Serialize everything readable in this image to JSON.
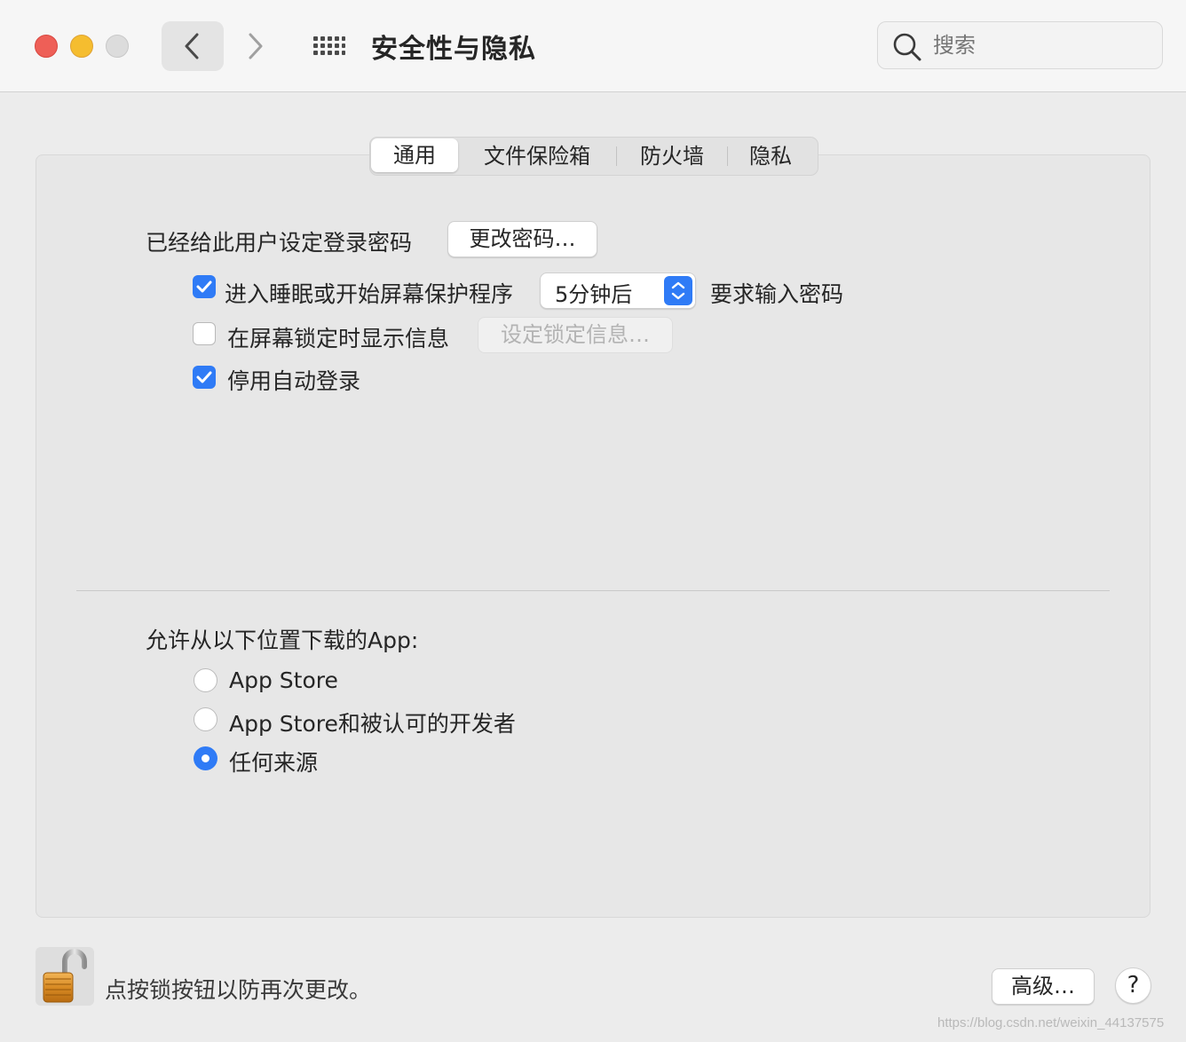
{
  "window": {
    "title": "安全性与隐私",
    "search_placeholder": "搜索"
  },
  "tabs": [
    {
      "label": "通用",
      "active": true
    },
    {
      "label": "文件保险箱",
      "active": false
    },
    {
      "label": "防火墙",
      "active": false
    },
    {
      "label": "隐私",
      "active": false
    }
  ],
  "general": {
    "password_set_label": "已经给此用户设定登录密码",
    "change_password_button": "更改密码…",
    "require_password": {
      "checked": true,
      "label_before": "进入睡眠或开始屏幕保护程序",
      "delay_value": "5分钟后",
      "label_after": "要求输入密码"
    },
    "show_message": {
      "checked": false,
      "label": "在屏幕锁定时显示信息",
      "button": "设定锁定信息…",
      "button_enabled": false
    },
    "disable_autologin": {
      "checked": true,
      "label": "停用自动登录"
    }
  },
  "app_downloads": {
    "heading": "允许从以下位置下载的App:",
    "options": [
      {
        "label": "App Store",
        "selected": false
      },
      {
        "label": "App Store和被认可的开发者",
        "selected": false
      },
      {
        "label": "任何来源",
        "selected": true
      }
    ]
  },
  "footer": {
    "lock_text": "点按锁按钮以防再次更改。",
    "advanced_button": "高级…",
    "help_button": "?",
    "watermark": "https://blog.csdn.net/weixin_44137575"
  },
  "colors": {
    "accent": "#2f7bf6",
    "close": "#ee5f57",
    "minimize": "#f5bd2f",
    "zoom_inactive": "#dcdcdc"
  }
}
